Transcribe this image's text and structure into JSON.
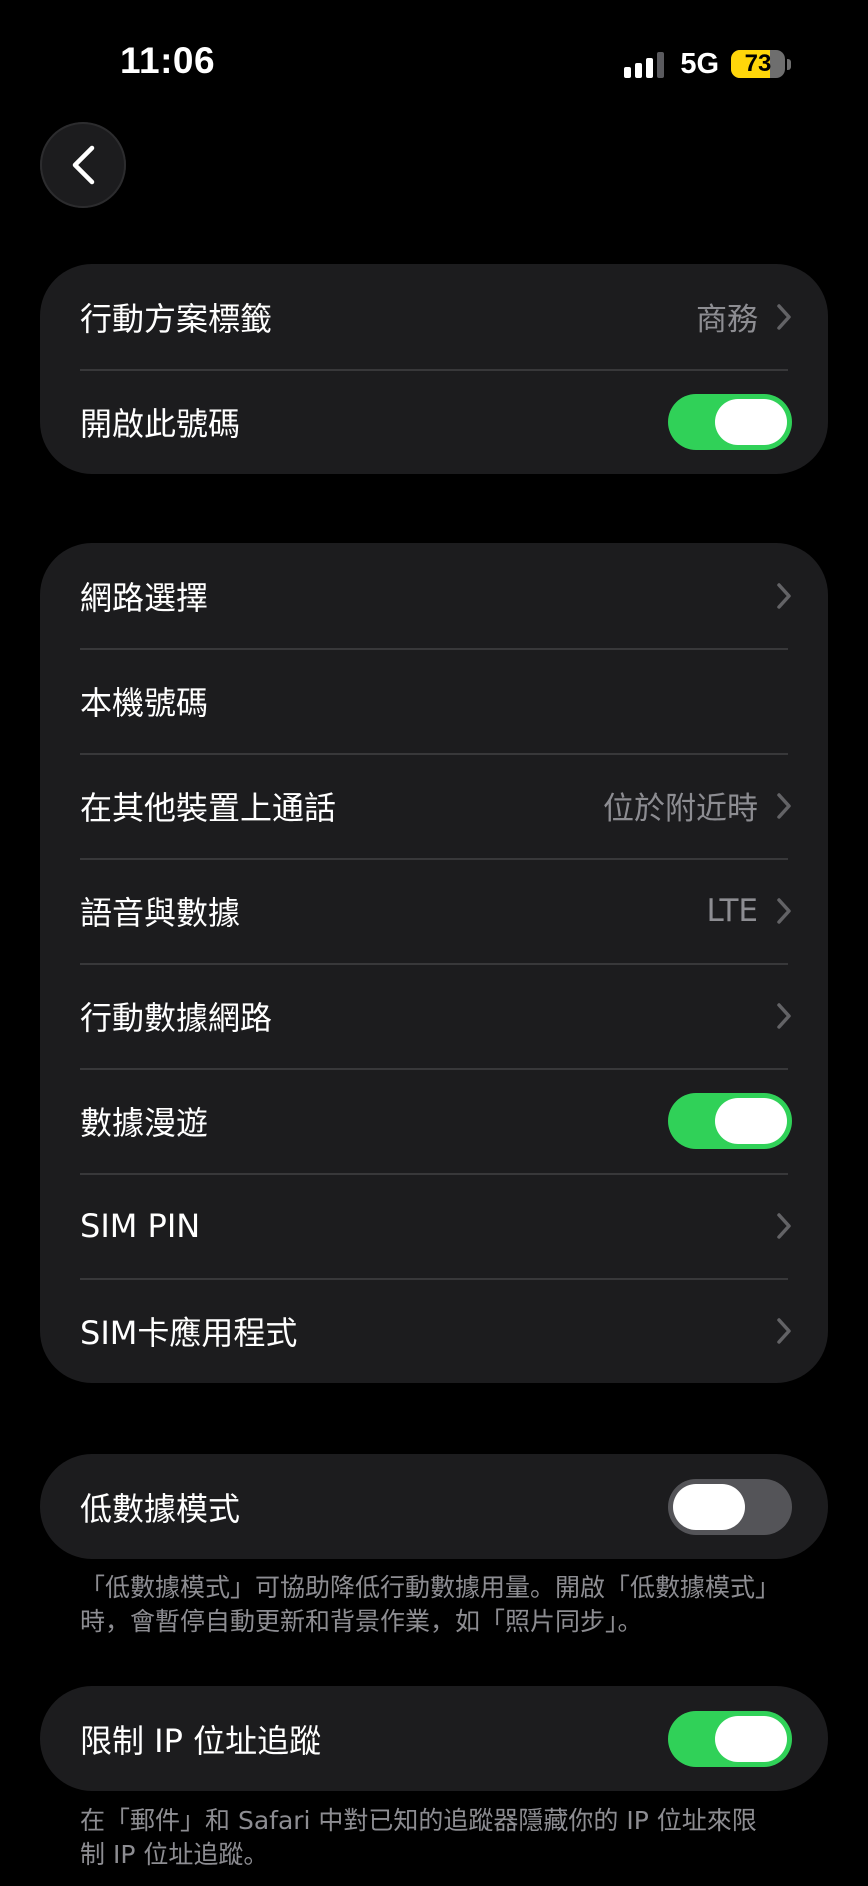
{
  "status_bar": {
    "time": "11:06",
    "network": "5G",
    "battery": "73",
    "battery_level": 0.73,
    "signal_bars_active": 3,
    "signal_bars_total": 4
  },
  "nav": {
    "back_icon": "chevron-left-icon"
  },
  "group1": {
    "plan_label": {
      "label": "行動方案標籤",
      "value": "商務"
    },
    "enable_number": {
      "label": "開啟此號碼",
      "on": true
    }
  },
  "group2": {
    "network_selection": {
      "label": "網路選擇"
    },
    "my_number": {
      "label": "本機號碼"
    },
    "calls_other_devices": {
      "label": "在其他裝置上通話",
      "value": "位於附近時"
    },
    "voice_data": {
      "label": "語音與數據",
      "value": "LTE"
    },
    "cellular_data_network": {
      "label": "行動數據網路"
    },
    "data_roaming": {
      "label": "數據漫遊",
      "on": true
    },
    "sim_pin": {
      "label": "SIM PIN"
    },
    "sim_apps": {
      "label": "SIM卡應用程式"
    }
  },
  "group3": {
    "low_data_mode": {
      "label": "低數據模式",
      "on": false
    },
    "footnote": "「低數據模式」可協助降低行動數據用量。開啟「低數據模式」時，會暫停自動更新和背景作業，如「照片同步」。"
  },
  "group4": {
    "limit_ip_tracking": {
      "label": "限制 IP 位址追蹤",
      "on": true
    },
    "footnote": "在「郵件」和 Safari 中對已知的追蹤器隱藏你的 IP 位址來限制 IP 位址追蹤。"
  },
  "colors": {
    "background": "#000000",
    "cell": "#1c1c1e",
    "toggle_on": "#30d158",
    "toggle_off": "#545458",
    "secondary_text": "#8d8d92",
    "battery": "#ffd60a"
  }
}
